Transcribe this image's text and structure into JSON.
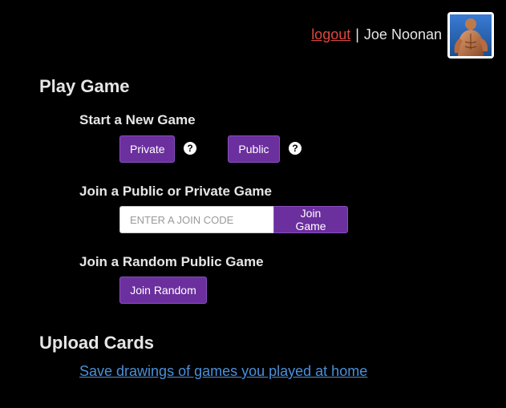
{
  "header": {
    "logout_label": "logout",
    "separator": "|",
    "username": "Joe Noonan"
  },
  "play_game": {
    "title": "Play Game",
    "new_game": {
      "heading": "Start a New Game",
      "private_label": "Private",
      "public_label": "Public",
      "help_glyph": "?"
    },
    "join_game": {
      "heading": "Join a Public or Private Game",
      "input_placeholder": "ENTER A JOIN CODE",
      "input_value": "",
      "button_label": "Join Game"
    },
    "join_random": {
      "heading": "Join a Random Public Game",
      "button_label": "Join Random"
    }
  },
  "upload_cards": {
    "title": "Upload Cards",
    "link_label": "Save drawings of games you played at home"
  },
  "colors": {
    "background": "#000000",
    "button": "#6b2f9e",
    "logout": "#e0463f",
    "link": "#4a90d9",
    "text": "#e6e6e6"
  },
  "icons": {
    "help": "question-circle-icon",
    "avatar": "user-avatar"
  }
}
